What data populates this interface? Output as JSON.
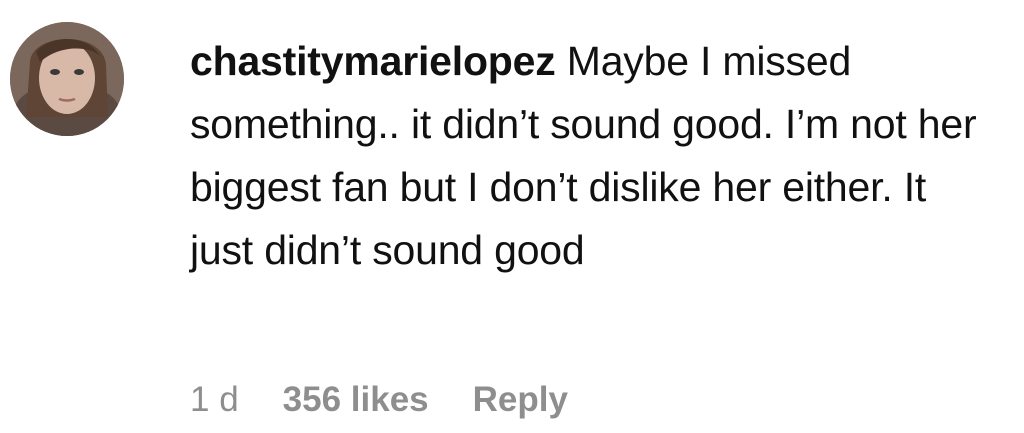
{
  "comment": {
    "avatar_icon": "user-profile-photo",
    "username": "chastitymarielopez",
    "text": "Maybe I missed something.. it didn’t sound good. I’m not her biggest fan but I don’t dislike her either. It just didn’t sound good",
    "time": "1 d",
    "likes": "356 likes",
    "reply_label": "Reply"
  },
  "colors": {
    "text": "#111111",
    "meta": "#8e8e8e",
    "background": "#ffffff"
  }
}
